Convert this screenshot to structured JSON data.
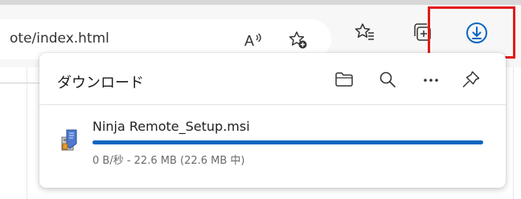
{
  "address_bar": {
    "url_fragment": "ote/index.html",
    "read_aloud_icon": "read-aloud-icon",
    "add_favorite_icon": "add-favorite-icon"
  },
  "toolbar": {
    "icons": [
      "favorites-icon",
      "collections-icon",
      "downloads-icon"
    ],
    "highlight_color": "#e21a1a",
    "accent_color": "#0a66c2"
  },
  "downloads_panel": {
    "title": "ダウンロード",
    "actions": [
      "open-folder-icon",
      "search-icon",
      "more-icon",
      "pin-icon"
    ],
    "items": [
      {
        "filename": "Ninja Remote_Setup.msi",
        "status": "0 B/秒 - 22.6 MB (22.6 MB 中)",
        "progress": 1.0
      }
    ]
  }
}
